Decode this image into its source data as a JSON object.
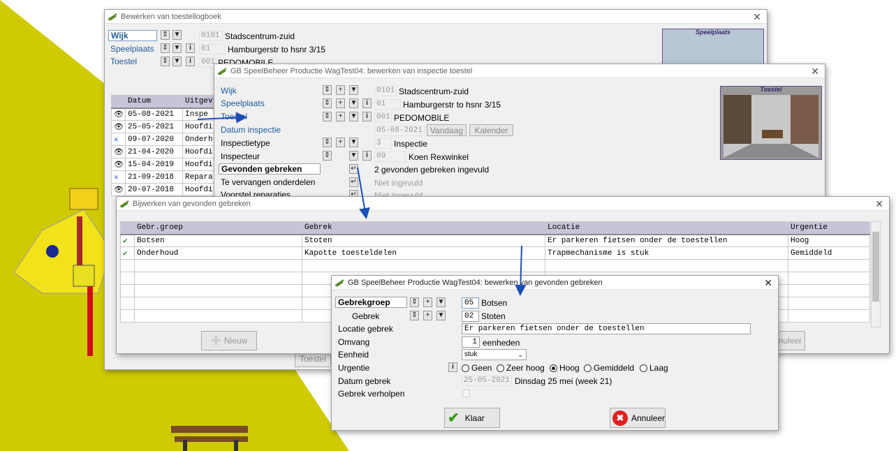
{
  "win1": {
    "title": "Bewerken van toestellogboek",
    "wijk_label": "Wijk",
    "speelplaats_label": "Speelplaats",
    "toestel_label": "Toestel",
    "wijk_code": "0101",
    "wijk_value": "Stadscentrum-zuid",
    "speelplaats_code": "01",
    "speelplaats_value": "Hamburgerstr to hsnr 3/15",
    "toestel_code": "001",
    "toestel_value": "PEDOMOBILE",
    "photo_title": "Speelplaats",
    "table_headers": [
      "Datum",
      "Uitgev"
    ],
    "rows": [
      {
        "icon": "eye",
        "date": "05-08-2021",
        "text": "Inspe"
      },
      {
        "icon": "wrench",
        "date": "25-05-2021",
        "text": "Hoofdi"
      },
      {
        "icon": "wrench",
        "date": "09-07-2020",
        "text": "Onderh"
      },
      {
        "icon": "eye",
        "date": "21-04-2020",
        "text": "Hoofdi"
      },
      {
        "icon": "eye",
        "date": "15-04-2019",
        "text": "Hoofdi"
      },
      {
        "icon": "wrench",
        "date": "21-09-2018",
        "text": "Repara"
      },
      {
        "icon": "eye",
        "date": "20-07-2018",
        "text": "Hoofdi"
      }
    ],
    "toestel_btn": "Toestel"
  },
  "win2": {
    "title": "GB SpeelBeheer Productie WagTest04: bewerken van inspectie toestel",
    "labels": {
      "wijk": "Wijk",
      "speelplaats": "Speelplaats",
      "toestel": "Toestel",
      "datum": "Datum inspectie",
      "inspectietype": "Inspectietype",
      "inspecteur": "Inspecteur",
      "gevonden": "Gevonden gebreken",
      "vervangen": "Te vervangen onderdelen",
      "voorstel": "Voorstel reparaties"
    },
    "wijk_code": "0101",
    "wijk_value": "Stadscentrum-zuid",
    "speelplaats_code": "01",
    "speelplaats_value": "Hamburgerstr to hsnr 3/15",
    "toestel_code": "001",
    "toestel_value": "PEDOMOBILE",
    "datum_value": "05-08-2021",
    "vandaag_btn": "Vandaag",
    "kalender_btn": "Kalender",
    "type_code": "3",
    "type_value": "Inspectie",
    "inspecteur_code": "09",
    "inspecteur_value": "Koen Rexwinkel",
    "gevonden_value": "2 gevonden gebreken ingevuld",
    "vervangen_value": "Niet ingevuld",
    "voorstel_value": "Niet ingevuld",
    "photo_title": "Toestel"
  },
  "win3": {
    "title": "Bijwerken van gevonden gebreken",
    "headers": [
      "Gebr.groep",
      "Gebrek",
      "Locatie",
      "Urgentie"
    ],
    "rows": [
      {
        "groep": "Botsen",
        "gebrek": "Stoten",
        "locatie": "Er parkeren fietsen onder de toestellen",
        "urgentie": "Hoog"
      },
      {
        "groep": "Onderhoud",
        "gebrek": "Kapotte toesteldelen",
        "locatie": "Trapmechanisme is stuk",
        "urgentie": "Gemiddeld"
      }
    ],
    "nieuw_btn": "Nieuw",
    "annuleer_btn": "nnuleer"
  },
  "win4": {
    "title": "GB SpeelBeheer Productie WagTest04: bewerken van gevonden gebreken",
    "labels": {
      "gebrekgroep": "Gebrekgroep",
      "gebrek": "Gebrek",
      "locatie": "Locatie gebrek",
      "omvang": "Omvang",
      "eenheid": "Eenheid",
      "urgentie": "Urgentie",
      "datum": "Datum gebrek",
      "verholpen": "Gebrek verholpen"
    },
    "gebrekgroep_code": "05",
    "gebrekgroep_value": "Botsen",
    "gebrek_code": "02",
    "gebrek_value": "Stoten",
    "locatie_value": "Er parkeren fietsen onder de toestellen",
    "omvang_value": "1",
    "omvang_unit": "eenheden",
    "eenheid_value": "stuk",
    "urgentie_options": [
      "Geen",
      "Zeer hoog",
      "Hoog",
      "Gemiddeld",
      "Laag"
    ],
    "urgentie_selected": "Hoog",
    "datum_value": "25-05-2021",
    "datum_text": "Dinsdag 25 mei (week 21)",
    "klaar_btn": "Klaar",
    "annuleer_btn": "Annuleer"
  },
  "colors": {
    "background_yellow": "#cfcb00",
    "accent_blue": "#1f5a9a",
    "header_lavender": "#c8c4d8",
    "arrow_blue": "#1a4fb5"
  }
}
